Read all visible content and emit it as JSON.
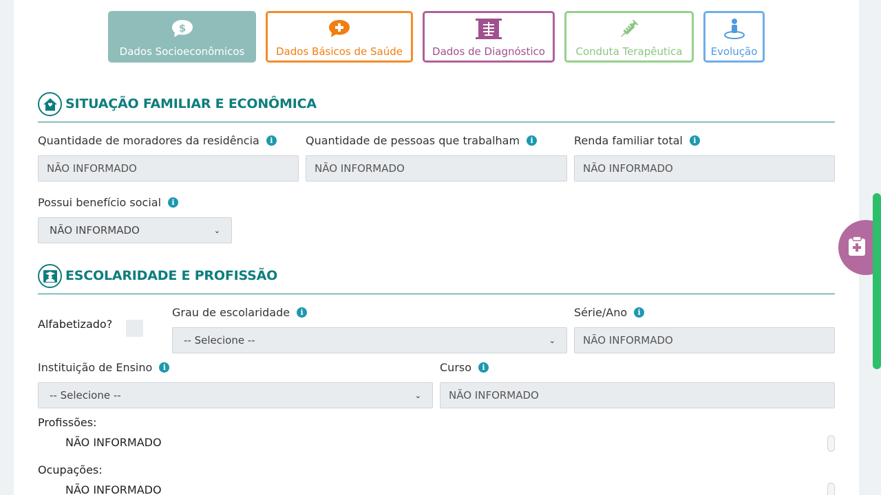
{
  "tabs": [
    {
      "label": "Dados Socioeconômicos",
      "icon": "dollar-speech-icon"
    },
    {
      "label": "Dados Básicos de Saúde",
      "icon": "plus-speech-icon"
    },
    {
      "label": "Dados de Diagnóstico",
      "icon": "xray-icon"
    },
    {
      "label": "Conduta Terapêutica",
      "icon": "syringe-icon"
    },
    {
      "label": "Evolução",
      "icon": "person-target-icon"
    }
  ],
  "colors": {
    "teal": "#0f7d7d",
    "socio_tab": "#8fbdb9",
    "saude_tab": "#f28c28",
    "diag_tab": "#b25e9a",
    "conduta_tab": "#95d18a",
    "evol_tab": "#6eaee8",
    "info": "#1d98ae",
    "fab": "#b36a9e",
    "scrollbar": "#2ebf6a"
  },
  "section_familiar": {
    "title": "SITUAÇÃO FAMILIAR E ECONÔMICA",
    "moradores_label": "Quantidade de moradores da residência",
    "moradores_value": "NÃO INFORMADO",
    "trabalham_label": "Quantidade de pessoas que trabalham",
    "trabalham_value": "NÃO INFORMADO",
    "renda_label": "Renda familiar total",
    "renda_value": "NÃO INFORMADO",
    "beneficio_label": "Possui benefício social",
    "beneficio_value": "NÃO INFORMADO"
  },
  "section_escolaridade": {
    "title": "ESCOLARIDADE E PROFISSÃO",
    "alfabetizado_label": "Alfabetizado?",
    "grau_label": "Grau de escolaridade",
    "grau_value": "-- Selecione --",
    "serie_label": "Série/Ano",
    "serie_value": "NÃO INFORMADO",
    "instituicao_label": "Instituição de Ensino",
    "instituicao_value": "-- Selecione --",
    "curso_label": "Curso",
    "curso_value": "NÃO INFORMADO",
    "profissoes_label": "Profissões:",
    "profissoes_value": "NÃO INFORMADO",
    "ocupacoes_label": "Ocupações:",
    "ocupacoes_value": "NÃO INFORMADO"
  },
  "info_glyph": "i",
  "chevron_glyph": "⌄"
}
